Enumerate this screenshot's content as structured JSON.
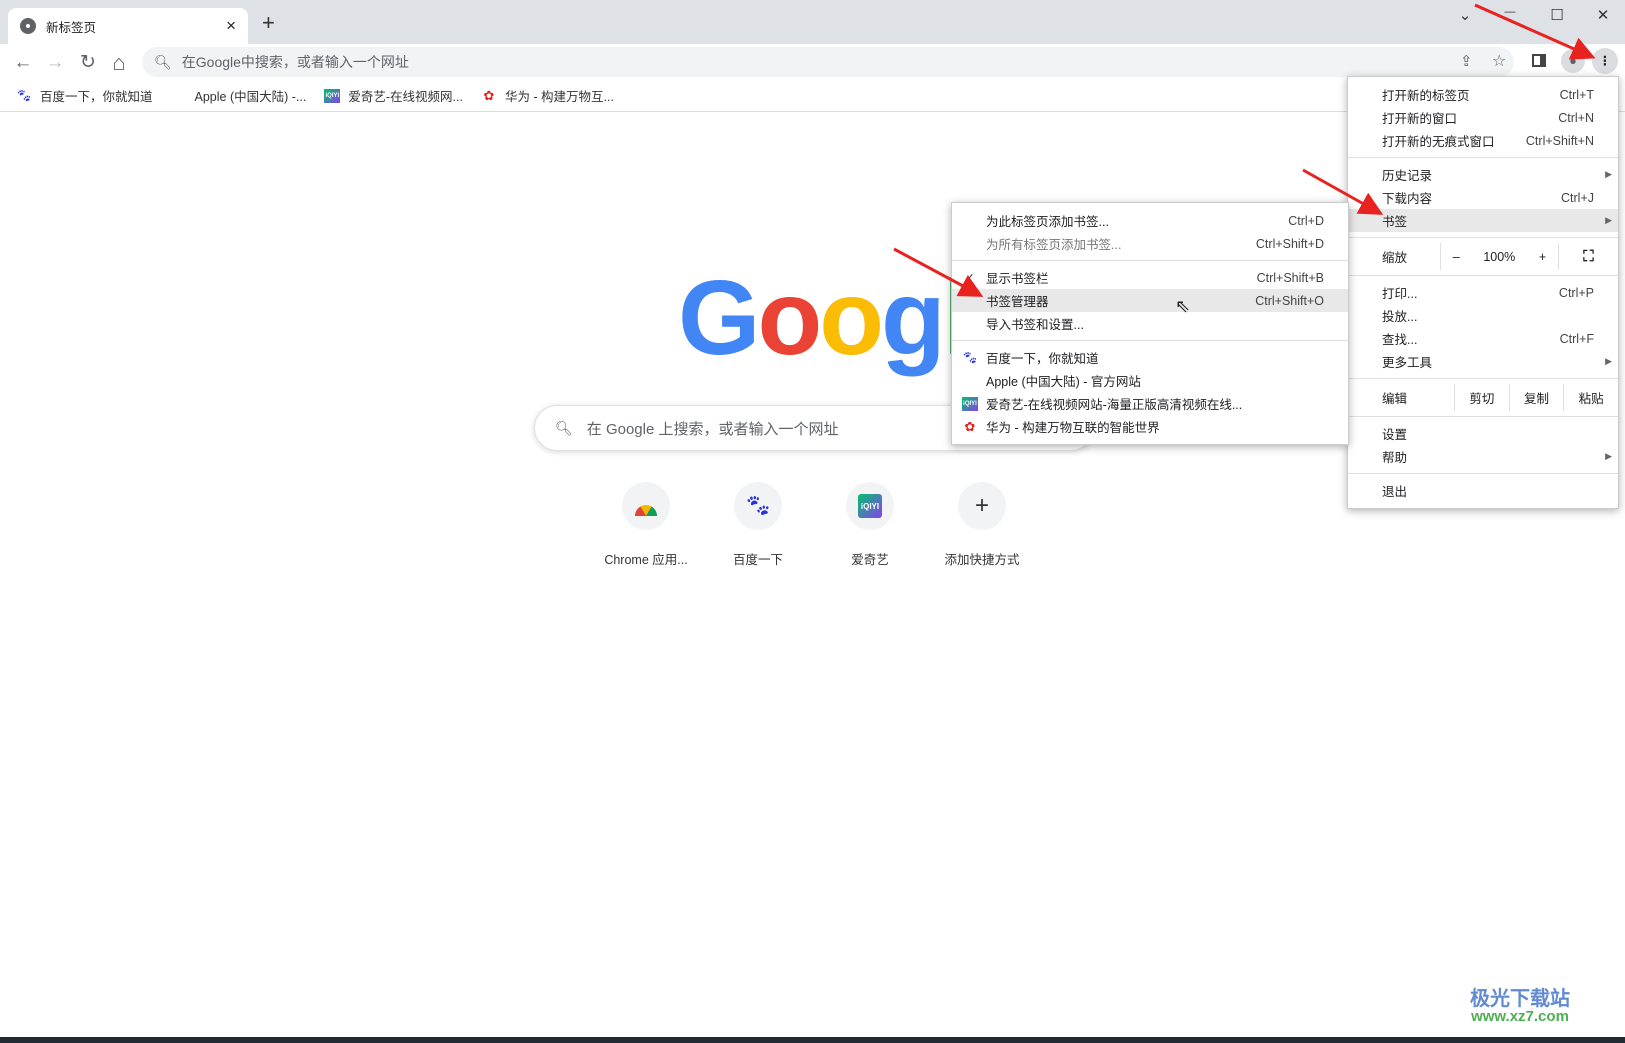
{
  "tab": {
    "title": "新标签页",
    "close": "×",
    "new_tab": "+"
  },
  "window": {
    "dropdown": "⌄",
    "minimize": "—",
    "maximize": "☐",
    "close": "✕"
  },
  "toolbar": {
    "back": "←",
    "forward": "→",
    "reload": "↻",
    "home": "⌂",
    "omnibox_placeholder": "在Google中搜索，或者输入一个网址"
  },
  "bookmarks": [
    {
      "label": "百度一下，你就知道",
      "icon": "baidu-icon"
    },
    {
      "label": "Apple (中国大陆) -...",
      "icon": "apple-icon"
    },
    {
      "label": "爱奇艺-在线视频网...",
      "icon": "iqiyi-icon"
    },
    {
      "label": "华为 - 构建万物互...",
      "icon": "huawei-icon"
    }
  ],
  "google": {
    "logo": "Google",
    "search_placeholder": "在 Google 上搜索，或者输入一个网址"
  },
  "shortcuts": [
    {
      "label": "Chrome 应用...",
      "icon": "chrome-apps-icon"
    },
    {
      "label": "百度一下",
      "icon": "baidu-icon"
    },
    {
      "label": "爱奇艺",
      "icon": "iqiyi-icon"
    },
    {
      "label": "添加快捷方式",
      "icon": "plus-icon"
    }
  ],
  "main_menu": {
    "groups": [
      [
        {
          "label": "打开新的标签页",
          "shortcut": "Ctrl+T"
        },
        {
          "label": "打开新的窗口",
          "shortcut": "Ctrl+N"
        },
        {
          "label": "打开新的无痕式窗口",
          "shortcut": "Ctrl+Shift+N"
        }
      ],
      [
        {
          "label": "历史记录",
          "submenu": true
        },
        {
          "label": "下载内容",
          "shortcut": "Ctrl+J"
        },
        {
          "label": "书签",
          "submenu": true,
          "highlighted": true
        }
      ],
      [
        {
          "zoom": true,
          "label": "缩放",
          "minus": "–",
          "value": "100%",
          "plus": "+"
        }
      ],
      [
        {
          "label": "打印...",
          "shortcut": "Ctrl+P"
        },
        {
          "label": "投放..."
        },
        {
          "label": "查找...",
          "shortcut": "Ctrl+F"
        },
        {
          "label": "更多工具",
          "submenu": true
        }
      ],
      [
        {
          "edit": true,
          "label": "编辑",
          "cut": "剪切",
          "copy": "复制",
          "paste": "粘贴"
        }
      ],
      [
        {
          "label": "设置"
        },
        {
          "label": "帮助",
          "submenu": true
        }
      ],
      [
        {
          "label": "退出"
        }
      ]
    ]
  },
  "bookmarks_submenu": {
    "groups": [
      [
        {
          "label": "为此标签页添加书签...",
          "shortcut": "Ctrl+D"
        },
        {
          "label": "为所有标签页添加书签...",
          "shortcut": "Ctrl+Shift+D",
          "disabled": true
        }
      ],
      [
        {
          "label": "显示书签栏",
          "shortcut": "Ctrl+Shift+B",
          "checked": true
        },
        {
          "label": "书签管理器",
          "shortcut": "Ctrl+Shift+O",
          "highlighted": true
        },
        {
          "label": "导入书签和设置..."
        }
      ],
      [
        {
          "label": "百度一下，你就知道",
          "icon": "baidu-icon"
        },
        {
          "label": "Apple (中国大陆) - 官方网站",
          "icon": "apple-icon"
        },
        {
          "label": "爱奇艺-在线视频网站-海量正版高清视频在线...",
          "icon": "iqiyi-icon"
        },
        {
          "label": "华为 - 构建万物互联的智能世界",
          "icon": "huawei-icon"
        }
      ]
    ]
  },
  "watermark": {
    "text": "极光下载站",
    "url": "www.xz7.com"
  },
  "colors": {
    "accent_arrow": "#e8231f",
    "menu_highlight": "#e8e8e9",
    "tabstrip": "#dee1e6"
  }
}
